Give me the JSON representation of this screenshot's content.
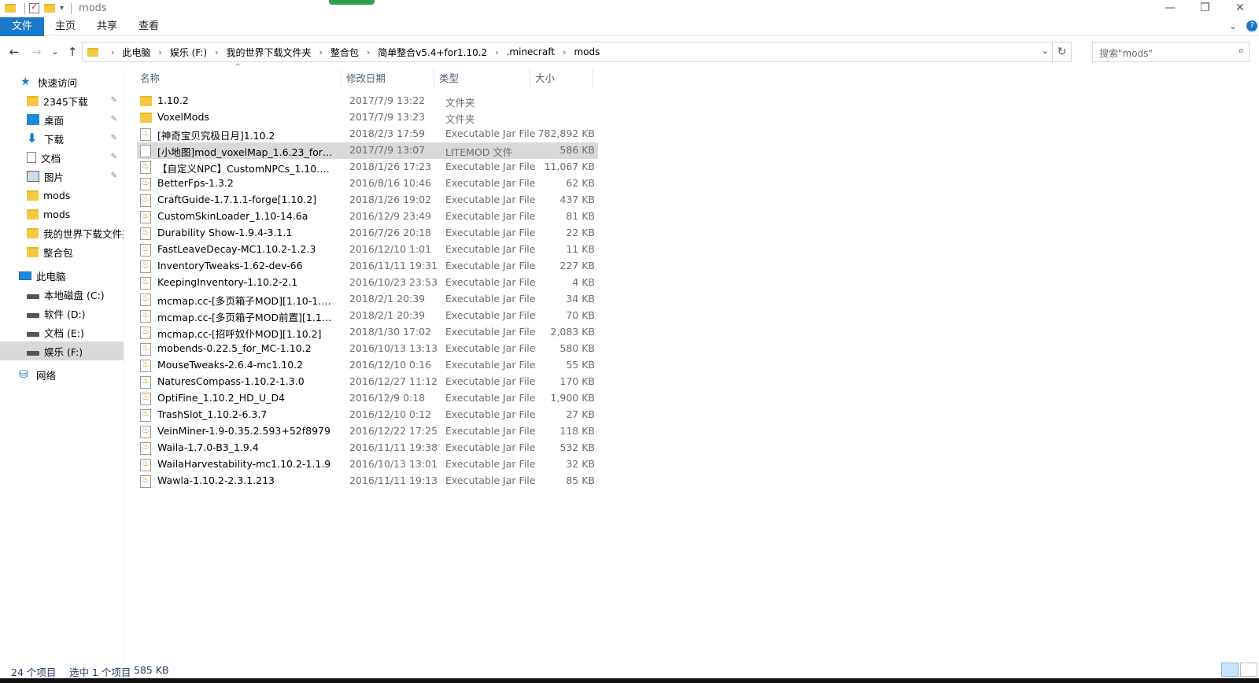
{
  "window": {
    "title": "mods",
    "min": "—",
    "max": "❐",
    "close": "✕"
  },
  "ribbon": {
    "tabs": [
      "文件",
      "主页",
      "共享",
      "查看"
    ],
    "expand": "⌄",
    "help": "?"
  },
  "nav": {
    "back": "←",
    "forward": "→",
    "recent": "⌄",
    "up": "↑",
    "breadcrumbs": [
      "此电脑",
      "娱乐 (F:)",
      "我的世界下载文件夹",
      "整合包",
      "简单整合v5.4+for1.10.2",
      ".minecraft",
      "mods"
    ],
    "crumb_sep": "›",
    "dropdown": "⌄",
    "refresh": "↻"
  },
  "search": {
    "placeholder": "搜索\"mods\"",
    "icon": "⌕"
  },
  "sidebar": {
    "quick_access": "快速访问",
    "items": [
      {
        "label": "2345下载",
        "icon": "folder-icon",
        "pinned": true
      },
      {
        "label": "桌面",
        "icon": "desktop-icon",
        "pinned": true
      },
      {
        "label": "下载",
        "icon": "download-icon",
        "pinned": true
      },
      {
        "label": "文档",
        "icon": "document-icon",
        "pinned": true
      },
      {
        "label": "图片",
        "icon": "picture-icon",
        "pinned": true
      },
      {
        "label": "mods",
        "icon": "folder-icon",
        "pinned": false
      },
      {
        "label": "mods",
        "icon": "folder-icon",
        "pinned": false
      },
      {
        "label": "我的世界下载文件夹",
        "icon": "folder-icon",
        "pinned": false
      },
      {
        "label": "整合包",
        "icon": "folder-icon",
        "pinned": false
      }
    ],
    "pin_glyph": "📌",
    "this_pc": "此电脑",
    "drives": [
      {
        "label": "本地磁盘 (C:)"
      },
      {
        "label": "软件 (D:)"
      },
      {
        "label": "文档 (E:)"
      },
      {
        "label": "娱乐 (F:)",
        "selected": true
      }
    ],
    "network": "网络"
  },
  "columns": {
    "name": "名称",
    "date": "修改日期",
    "type": "类型",
    "size": "大小",
    "sort_arrow": "^"
  },
  "files": [
    {
      "name": "1.10.2",
      "date": "2017/7/9 13:22",
      "type": "文件夹",
      "size": "",
      "kind": "folder"
    },
    {
      "name": "VoxelMods",
      "date": "2017/7/9 13:23",
      "type": "文件夹",
      "size": "",
      "kind": "folder"
    },
    {
      "name": "[神奇宝贝究极日月]1.10.2",
      "date": "2018/2/3 17:59",
      "type": "Executable Jar File",
      "size": "782,892 KB",
      "kind": "jar"
    },
    {
      "name": "[小地图]mod_voxelMap_1.6.23_for_1.1...",
      "date": "2017/7/9 13:07",
      "type": "LITEMOD 文件",
      "size": "586 KB",
      "kind": "file",
      "selected": true
    },
    {
      "name": "【自定义NPC】CustomNPCs_1.10.2(21...",
      "date": "2018/1/26 17:23",
      "type": "Executable Jar File",
      "size": "11,067 KB",
      "kind": "jar"
    },
    {
      "name": "BetterFps-1.3.2",
      "date": "2016/8/16 10:46",
      "type": "Executable Jar File",
      "size": "62 KB",
      "kind": "jar"
    },
    {
      "name": "CraftGuide-1.7.1.1-forge[1.10.2]",
      "date": "2018/1/26 19:02",
      "type": "Executable Jar File",
      "size": "437 KB",
      "kind": "jar"
    },
    {
      "name": "CustomSkinLoader_1.10-14.6a",
      "date": "2016/12/9 23:49",
      "type": "Executable Jar File",
      "size": "81 KB",
      "kind": "jar"
    },
    {
      "name": "Durability Show-1.9.4-3.1.1",
      "date": "2016/7/26 20:18",
      "type": "Executable Jar File",
      "size": "22 KB",
      "kind": "jar"
    },
    {
      "name": "FastLeaveDecay-MC1.10.2-1.2.3",
      "date": "2016/12/10 1:01",
      "type": "Executable Jar File",
      "size": "11 KB",
      "kind": "jar"
    },
    {
      "name": "InventoryTweaks-1.62-dev-66",
      "date": "2016/11/11 19:31",
      "type": "Executable Jar File",
      "size": "227 KB",
      "kind": "jar"
    },
    {
      "name": "KeepingInventory-1.10.2-2.1",
      "date": "2016/10/23 23:53",
      "type": "Executable Jar File",
      "size": "4 KB",
      "kind": "jar"
    },
    {
      "name": "mcmap.cc-[多页箱子MOD][1.10-1.10.2]",
      "date": "2018/2/1 20:39",
      "type": "Executable Jar File",
      "size": "34 KB",
      "kind": "jar"
    },
    {
      "name": "mcmap.cc-[多页箱子MOD前置][1.10-1....",
      "date": "2018/2/1 20:39",
      "type": "Executable Jar File",
      "size": "70 KB",
      "kind": "jar"
    },
    {
      "name": "mcmap.cc-[招呼奴仆MOD][1.10.2]",
      "date": "2018/1/30 17:02",
      "type": "Executable Jar File",
      "size": "2,083 KB",
      "kind": "jar"
    },
    {
      "name": "mobends-0.22.5_for_MC-1.10.2",
      "date": "2016/10/13 13:13",
      "type": "Executable Jar File",
      "size": "580 KB",
      "kind": "jar"
    },
    {
      "name": "MouseTweaks-2.6.4-mc1.10.2",
      "date": "2016/12/10 0:16",
      "type": "Executable Jar File",
      "size": "55 KB",
      "kind": "jar"
    },
    {
      "name": "NaturesCompass-1.10.2-1.3.0",
      "date": "2016/12/27 11:12",
      "type": "Executable Jar File",
      "size": "170 KB",
      "kind": "jar"
    },
    {
      "name": "OptiFine_1.10.2_HD_U_D4",
      "date": "2016/12/9 0:18",
      "type": "Executable Jar File",
      "size": "1,900 KB",
      "kind": "jar"
    },
    {
      "name": "TrashSlot_1.10.2-6.3.7",
      "date": "2016/12/10 0:12",
      "type": "Executable Jar File",
      "size": "27 KB",
      "kind": "jar"
    },
    {
      "name": "VeinMiner-1.9-0.35.2.593+52f8979",
      "date": "2016/12/22 17:25",
      "type": "Executable Jar File",
      "size": "118 KB",
      "kind": "jar"
    },
    {
      "name": "Waila-1.7.0-B3_1.9.4",
      "date": "2016/11/11 19:38",
      "type": "Executable Jar File",
      "size": "532 KB",
      "kind": "jar"
    },
    {
      "name": "WailaHarvestability-mc1.10.2-1.1.9",
      "date": "2016/10/13 13:01",
      "type": "Executable Jar File",
      "size": "32 KB",
      "kind": "jar"
    },
    {
      "name": "Wawla-1.10.2-2.3.1.213",
      "date": "2016/11/11 19:13",
      "type": "Executable Jar File",
      "size": "85 KB",
      "kind": "jar"
    }
  ],
  "status": {
    "count": "24 个项目",
    "selected": "选中 1 个项目",
    "size": "585 KB"
  },
  "colors": {
    "accent": "#1979ca",
    "selection": "#d9d9d9",
    "folder": "#f5c842"
  }
}
